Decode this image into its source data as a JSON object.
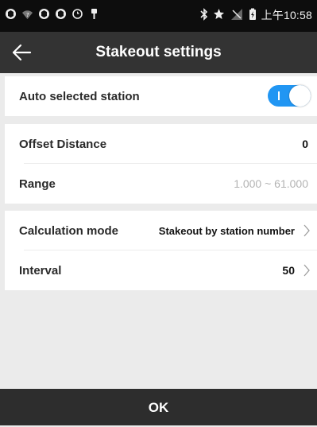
{
  "status_bar": {
    "time": "上午10:58",
    "icons": [
      "app-icon",
      "wifi-question-icon",
      "app-icon",
      "app-icon",
      "sync-icon",
      "usb-icon",
      "bluetooth-icon",
      "star-icon",
      "no-signal-icon",
      "battery-charging-icon"
    ]
  },
  "header": {
    "title": "Stakeout settings",
    "back_icon": "arrow-left-icon"
  },
  "settings": {
    "auto_selected_station": {
      "label": "Auto selected station",
      "toggle_on": true,
      "accent": "#2196f3"
    },
    "offset_distance": {
      "label": "Offset Distance",
      "value": "0"
    },
    "range": {
      "label": "Range",
      "value": "1.000 ~ 61.000"
    },
    "calculation_mode": {
      "label": "Calculation mode",
      "value": "Stakeout by station number"
    },
    "interval": {
      "label": "Interval",
      "value": "50"
    }
  },
  "footer": {
    "ok_label": "OK"
  }
}
